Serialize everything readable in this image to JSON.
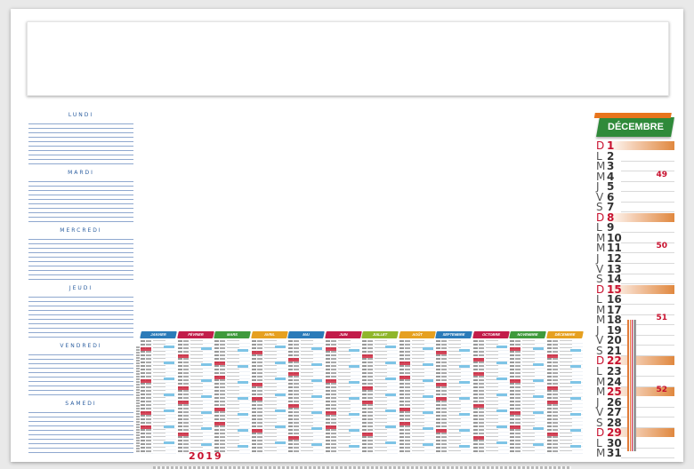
{
  "planner": {
    "days": [
      "LUNDI",
      "MARDI",
      "MERCREDI",
      "JEUDI",
      "VENDREDI",
      "SAMEDI"
    ]
  },
  "months": [
    {
      "name": "JANVIER",
      "color": "#2b7bb9"
    },
    {
      "name": "FÉVRIER",
      "color": "#c21d4a"
    },
    {
      "name": "MARS",
      "color": "#3f9a3c"
    },
    {
      "name": "AVRIL",
      "color": "#e6a020"
    },
    {
      "name": "MAI",
      "color": "#2b7bb9"
    },
    {
      "name": "JUIN",
      "color": "#c21d4a"
    },
    {
      "name": "JUILLET",
      "color": "#8fb62a"
    },
    {
      "name": "AOÛT",
      "color": "#e6a020"
    },
    {
      "name": "SEPTEMBRE",
      "color": "#2b7bb9"
    },
    {
      "name": "OCTOBRE",
      "color": "#c21d4a"
    },
    {
      "name": "NOVEMBRE",
      "color": "#3f9a3c"
    },
    {
      "name": "DÉCEMBRE",
      "color": "#e6a020"
    }
  ],
  "year": "2019",
  "december": {
    "title": "DÉCEMBRE",
    "days": [
      {
        "l": "D",
        "n": "1"
      },
      {
        "l": "L",
        "n": "2"
      },
      {
        "l": "M",
        "n": "3"
      },
      {
        "l": "M",
        "n": "4"
      },
      {
        "l": "J",
        "n": "5"
      },
      {
        "l": "V",
        "n": "6"
      },
      {
        "l": "S",
        "n": "7"
      },
      {
        "l": "D",
        "n": "8"
      },
      {
        "l": "L",
        "n": "9"
      },
      {
        "l": "M",
        "n": "10"
      },
      {
        "l": "M",
        "n": "11"
      },
      {
        "l": "J",
        "n": "12"
      },
      {
        "l": "V",
        "n": "13"
      },
      {
        "l": "S",
        "n": "14"
      },
      {
        "l": "D",
        "n": "15"
      },
      {
        "l": "L",
        "n": "16"
      },
      {
        "l": "M",
        "n": "17"
      },
      {
        "l": "M",
        "n": "18"
      },
      {
        "l": "J",
        "n": "19"
      },
      {
        "l": "V",
        "n": "20"
      },
      {
        "l": "S",
        "n": "21"
      },
      {
        "l": "D",
        "n": "22"
      },
      {
        "l": "L",
        "n": "23"
      },
      {
        "l": "M",
        "n": "24"
      },
      {
        "l": "M",
        "n": "25"
      },
      {
        "l": "J",
        "n": "26"
      },
      {
        "l": "V",
        "n": "27"
      },
      {
        "l": "S",
        "n": "28"
      },
      {
        "l": "D",
        "n": "29"
      },
      {
        "l": "L",
        "n": "30"
      },
      {
        "l": "M",
        "n": "31"
      }
    ],
    "weeks": {
      "4": "49",
      "11": "50",
      "18": "51",
      "25": "52"
    }
  }
}
